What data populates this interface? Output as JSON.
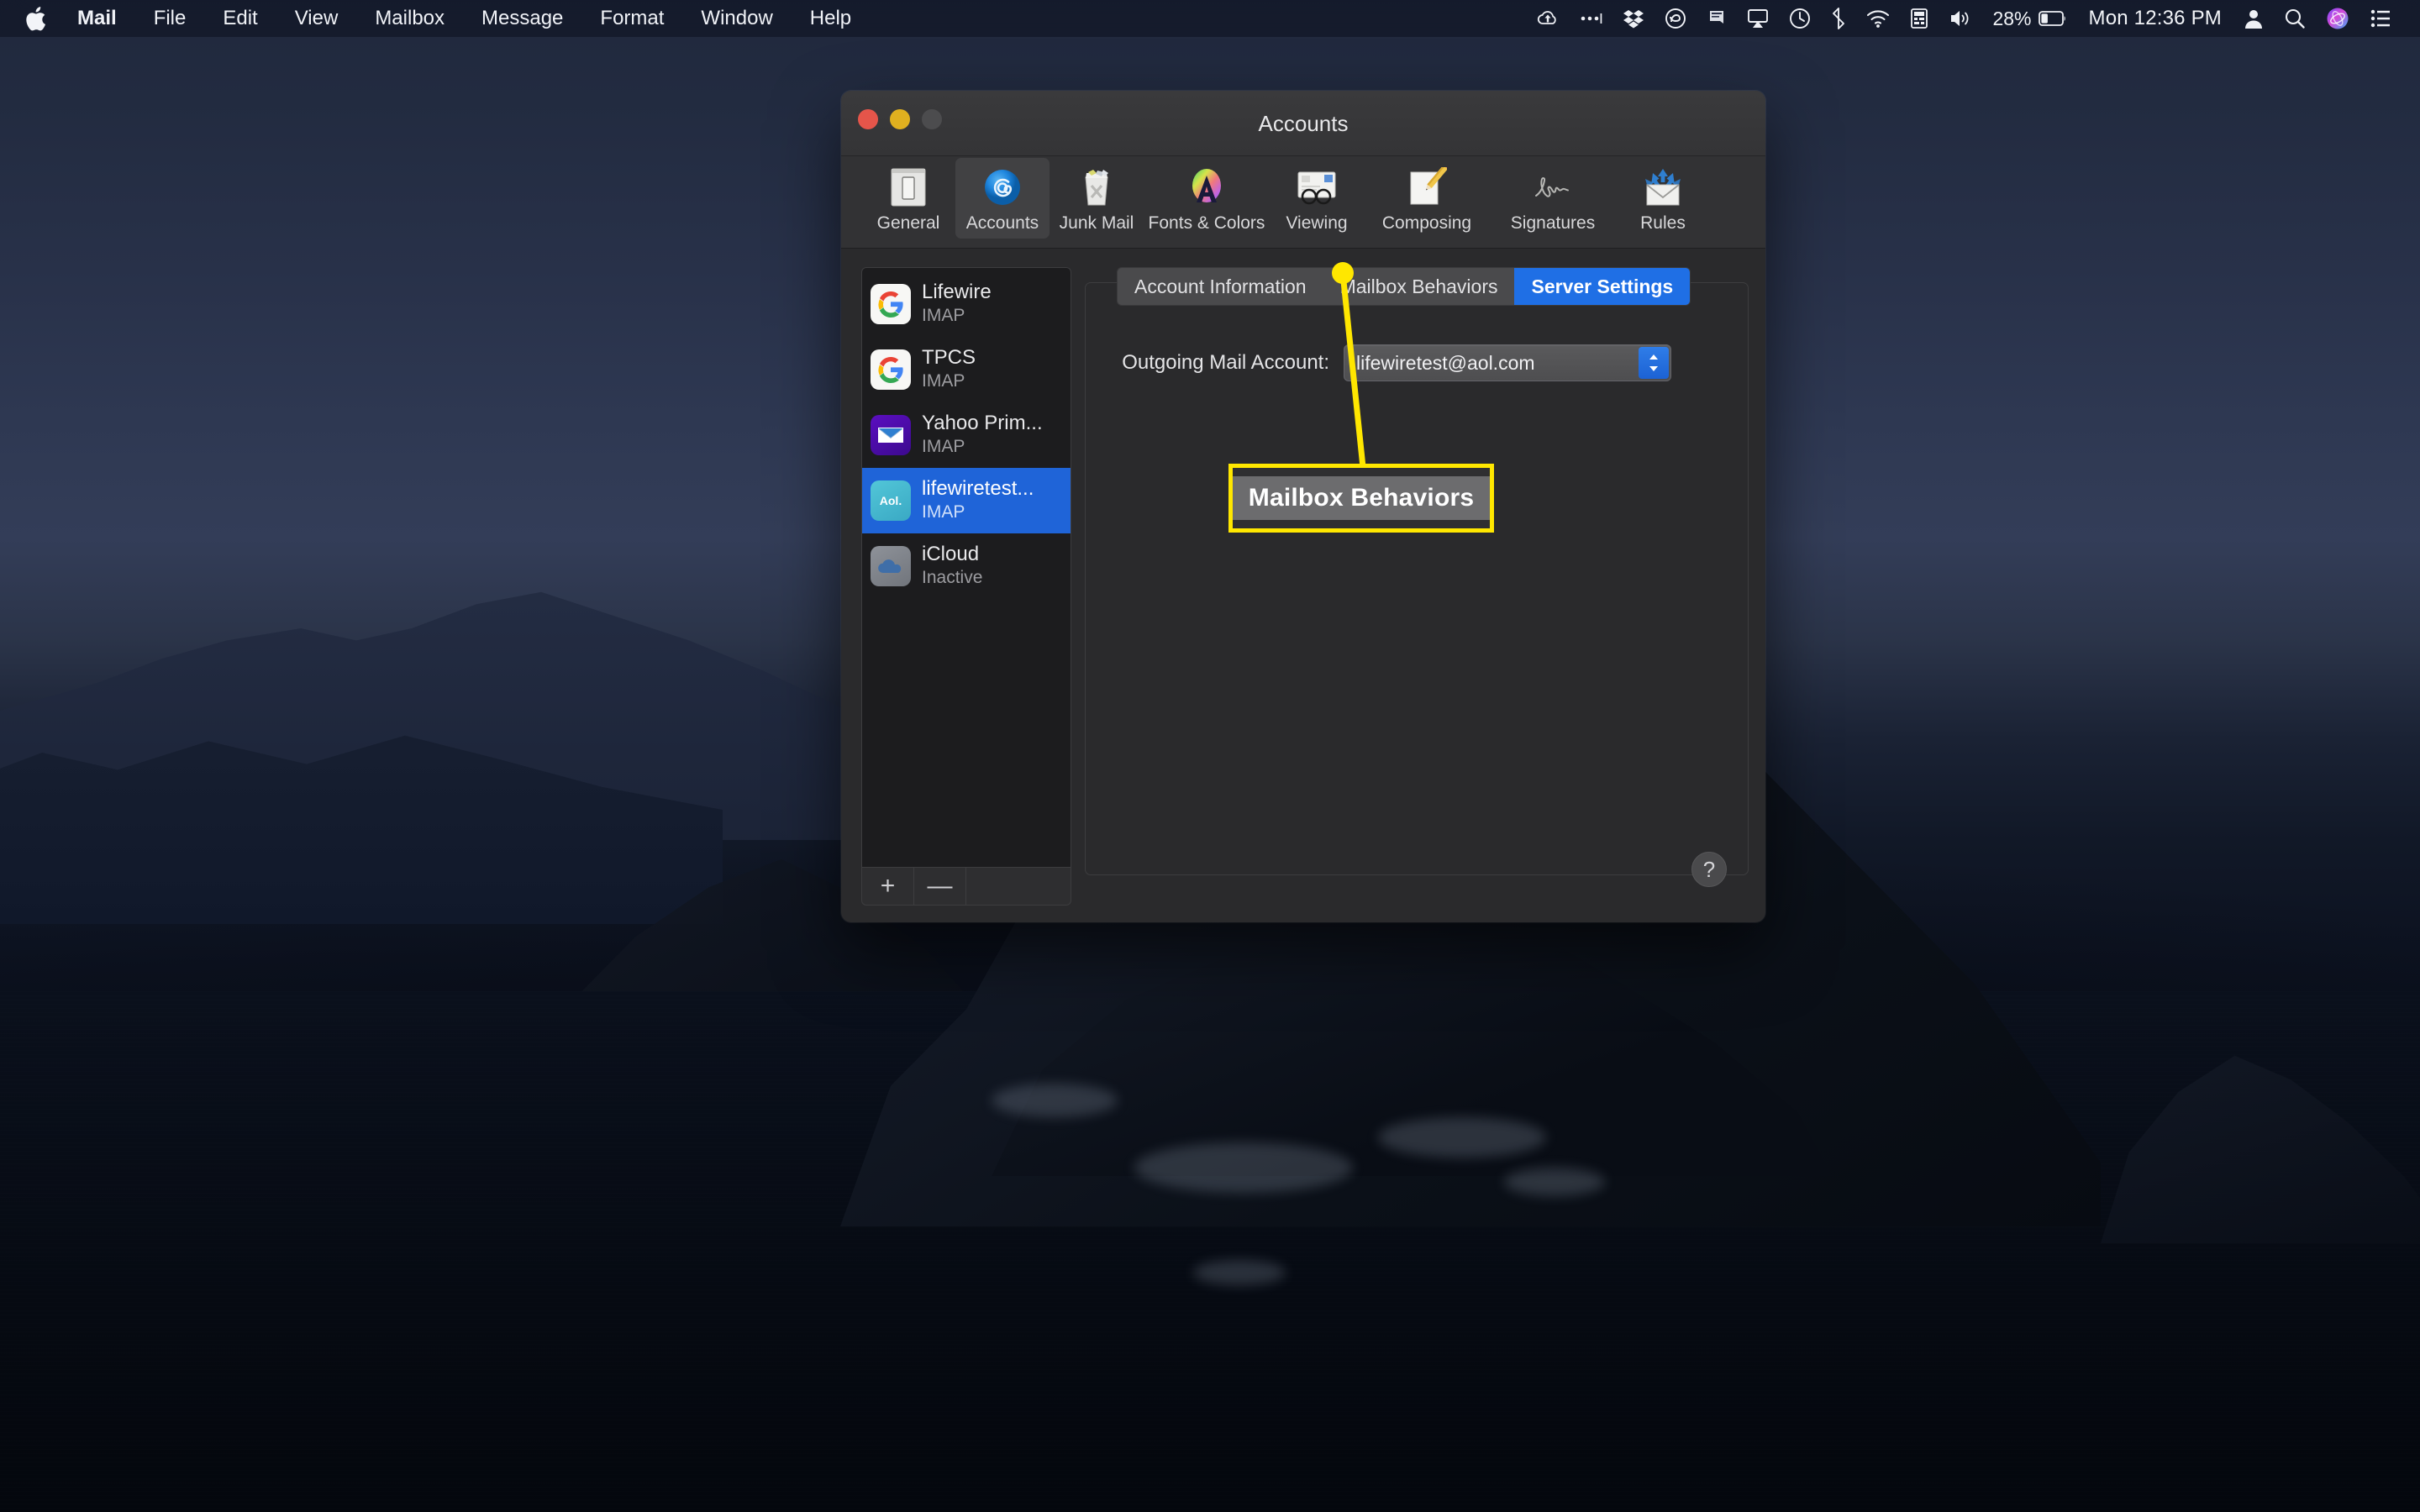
{
  "menubar": {
    "apple_icon": "apple-logo-icon",
    "items": [
      {
        "label": "Mail",
        "bold": true
      },
      {
        "label": "File",
        "bold": false
      },
      {
        "label": "Edit",
        "bold": false
      },
      {
        "label": "View",
        "bold": false
      },
      {
        "label": "Mailbox",
        "bold": false
      },
      {
        "label": "Message",
        "bold": false
      },
      {
        "label": "Format",
        "bold": false
      },
      {
        "label": "Window",
        "bold": false
      },
      {
        "label": "Help",
        "bold": false
      }
    ],
    "tray_icons": [
      "cloud-upload-icon",
      "ellipsis-icon",
      "dropbox-icon",
      "creative-cloud-icon",
      "notification-bell-icon",
      "airplay-icon",
      "time-machine-icon",
      "bluetooth-icon",
      "wifi-icon",
      "input-source-icon",
      "volume-icon"
    ],
    "battery_percent": "28%",
    "battery_icon": "battery-icon",
    "clock": "Mon 12:36 PM",
    "right_icons": [
      "user-account-icon",
      "spotlight-search-icon",
      "siri-icon",
      "control-center-icon"
    ]
  },
  "window": {
    "title": "Accounts",
    "traffic_lights": [
      "close-button",
      "minimize-button",
      "zoom-button"
    ],
    "toolbar": [
      {
        "label": "General",
        "icon": "general-prefs-icon",
        "selected": false
      },
      {
        "label": "Accounts",
        "icon": "accounts-at-icon",
        "selected": true
      },
      {
        "label": "Junk Mail",
        "icon": "junk-mail-trash-icon",
        "selected": false
      },
      {
        "label": "Fonts & Colors",
        "icon": "fonts-colors-icon",
        "selected": false
      },
      {
        "label": "Viewing",
        "icon": "viewing-glasses-icon",
        "selected": false
      },
      {
        "label": "Composing",
        "icon": "composing-pencil-icon",
        "selected": false
      },
      {
        "label": "Signatures",
        "icon": "signature-icon",
        "selected": false
      },
      {
        "label": "Rules",
        "icon": "rules-envelope-icon",
        "selected": false
      }
    ]
  },
  "accounts": {
    "list": [
      {
        "name": "Lifewire",
        "type": "IMAP",
        "icon": "google-icon",
        "selected": false
      },
      {
        "name": "TPCS",
        "type": "IMAP",
        "icon": "google-icon",
        "selected": false
      },
      {
        "name": "Yahoo Prim...",
        "type": "IMAP",
        "icon": "yahoo-icon",
        "selected": false
      },
      {
        "name": "lifewiretest...",
        "type": "IMAP",
        "icon": "aol-icon",
        "selected": true
      },
      {
        "name": "iCloud",
        "type": "Inactive",
        "icon": "icloud-icon",
        "selected": false
      }
    ],
    "add_button": "+",
    "remove_button": "—"
  },
  "detail": {
    "tabs": [
      {
        "label": "Account Information",
        "active": false
      },
      {
        "label": "Mailbox Behaviors",
        "active": false
      },
      {
        "label": "Server Settings",
        "active": true
      }
    ],
    "outgoing_label": "Outgoing Mail Account:",
    "outgoing_value": "lifewiretest@aol.com",
    "help_button": "?"
  },
  "annotation": {
    "callout_text": "Mailbox Behaviors",
    "highlight_color": "#ffe700"
  }
}
